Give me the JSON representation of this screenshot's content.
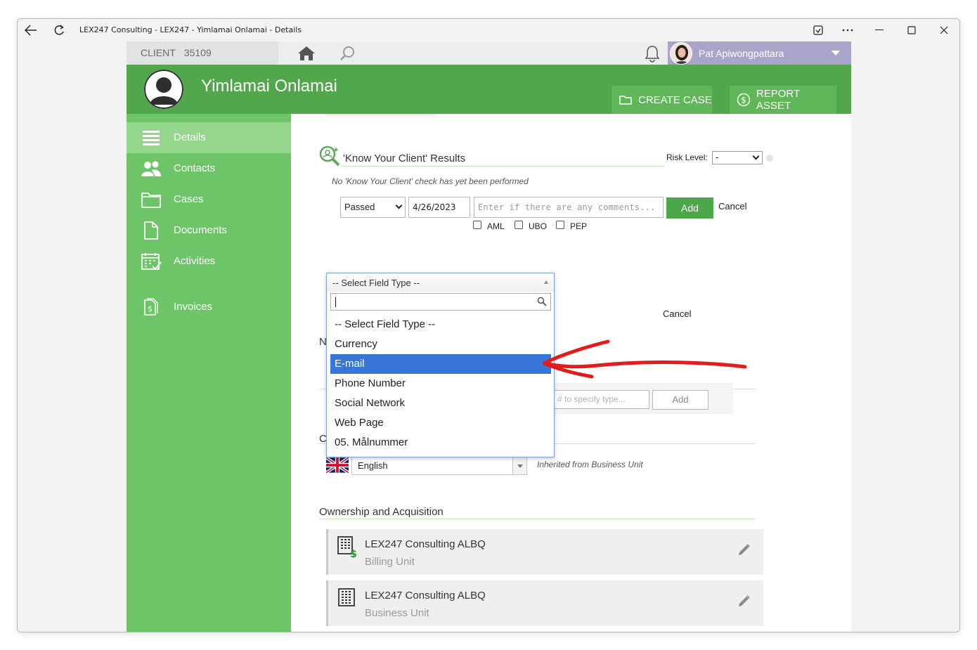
{
  "window": {
    "title": "LEX247 Consulting - LEX247 - Yimlamai Onlamai - Details"
  },
  "topbar": {
    "client_label": "CLIENT",
    "client_number": "35109",
    "user_name": "Pat Apiwongpattara"
  },
  "header": {
    "client_name": "Yimlamai Onlamai",
    "create_case_label": "CREATE CASE",
    "report_asset_label": "REPORT ASSET",
    "accent_color": "#52a64b"
  },
  "sidebar": {
    "items": [
      {
        "label": "Details",
        "icon": "details-icon"
      },
      {
        "label": "Contacts",
        "icon": "contacts-icon"
      },
      {
        "label": "Cases",
        "icon": "folder-icon"
      },
      {
        "label": "Documents",
        "icon": "document-icon"
      },
      {
        "label": "Activities",
        "icon": "calendar-check-icon"
      },
      {
        "label": "Invoices",
        "icon": "invoice-icon"
      }
    ]
  },
  "kyc": {
    "title": "'Know Your Client' Results",
    "risk_label": "Risk Level:",
    "risk_value": "-",
    "note": "No 'Know Your Client' check has yet been performed",
    "status_value": "Passed",
    "date_value": "4/26/2023",
    "comments_placeholder": "Enter if there are any comments...",
    "add_label": "Add",
    "cancel_label": "Cancel",
    "checks": [
      "AML",
      "UBO",
      "PEP"
    ]
  },
  "contact_info": {
    "cancel_label": "Cancel",
    "section_initial": "N",
    "type_placeholder": "# to specify type...",
    "add_label": "Add"
  },
  "language": {
    "section_initial": "C",
    "value": "English",
    "inherited_note": "Inherited from Business Unit"
  },
  "ownership": {
    "title": "Ownership and Acquisition",
    "cards": [
      {
        "name": "LEX247 Consulting ALBQ",
        "type": "Billing Unit"
      },
      {
        "name": "LEX247 Consulting ALBQ",
        "type": "Business Unit"
      }
    ]
  },
  "field_type_dropdown": {
    "selected": "-- Select Field Type --",
    "highlight_color": "#3876d7",
    "options": [
      "-- Select Field Type --",
      "Currency",
      "E-mail",
      "Phone Number",
      "Social Network",
      "Web Page",
      "05. Målnummer"
    ],
    "highlighted_option": "E-mail"
  }
}
